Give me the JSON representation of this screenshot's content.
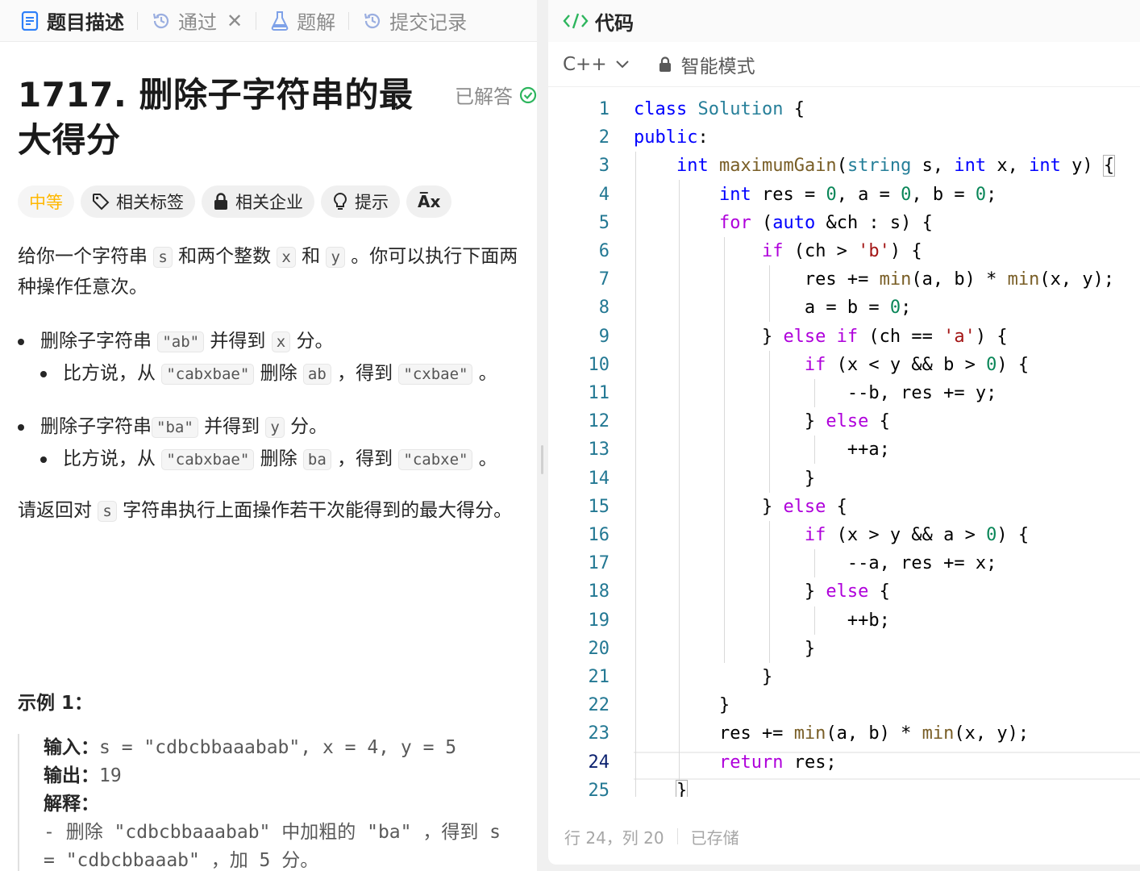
{
  "left_tabs": [
    {
      "label": "题目描述"
    },
    {
      "label": "通过"
    },
    {
      "label": "题解"
    },
    {
      "label": "提交记录"
    }
  ],
  "problem": {
    "title": "1717. 删除子字符串的最大得分",
    "status": "已解答",
    "difficulty": "中等",
    "chips": [
      "相关标签",
      "相关企业",
      "提示",
      "A̅x"
    ]
  },
  "description": {
    "p1_a": "给你一个字符串 ",
    "p1_s": "s",
    "p1_b": " 和两个整数 ",
    "p1_x": "x",
    "p1_c": " 和 ",
    "p1_y": "y",
    "p1_d": " 。你可以执行下面两种操作任意次。",
    "b1_a": "删除子字符串 ",
    "b1_code": "\"ab\"",
    "b1_b": " 并得到 ",
    "b1_x": "x",
    "b1_c": " 分。",
    "b1s_a": "比方说，从 ",
    "b1s_code1": "\"cabxbae\"",
    "b1s_b": " 删除 ",
    "b1s_code2": "ab",
    "b1s_c": " ，得到 ",
    "b1s_code3": "\"cxbae\"",
    "b1s_d": " 。",
    "b2_a": "删除子字符串",
    "b2_code": "\"ba\"",
    "b2_b": " 并得到 ",
    "b2_y": "y",
    "b2_c": " 分。",
    "b2s_a": "比方说，从 ",
    "b2s_code1": "\"cabxbae\"",
    "b2s_b": " 删除 ",
    "b2s_code2": "ba",
    "b2s_c": " ，得到 ",
    "b2s_code3": "\"cabxe\"",
    "b2s_d": " 。",
    "p2_a": "请返回对 ",
    "p2_s": "s",
    "p2_b": " 字符串执行上面操作若干次能得到的最大得分。"
  },
  "example": {
    "title": "示例 1：",
    "input_label": "输入：",
    "input_value": "s = \"cdbcbbaaabab\", x = 4, y = 5",
    "output_label": "输出：",
    "output_value": "19",
    "explain_label": "解释：",
    "explain_line1": "- 删除 \"cdbcbbaaabab\" 中加粗的 \"ba\" ，得到 s",
    "explain_line2": "= \"cdbcbbaaab\" ，加 5 分。"
  },
  "code_panel": {
    "title": "代码",
    "language": "C++",
    "mode": "智能模式"
  },
  "status_bar": {
    "position": "行 24，列 20",
    "saved": "已存储"
  }
}
